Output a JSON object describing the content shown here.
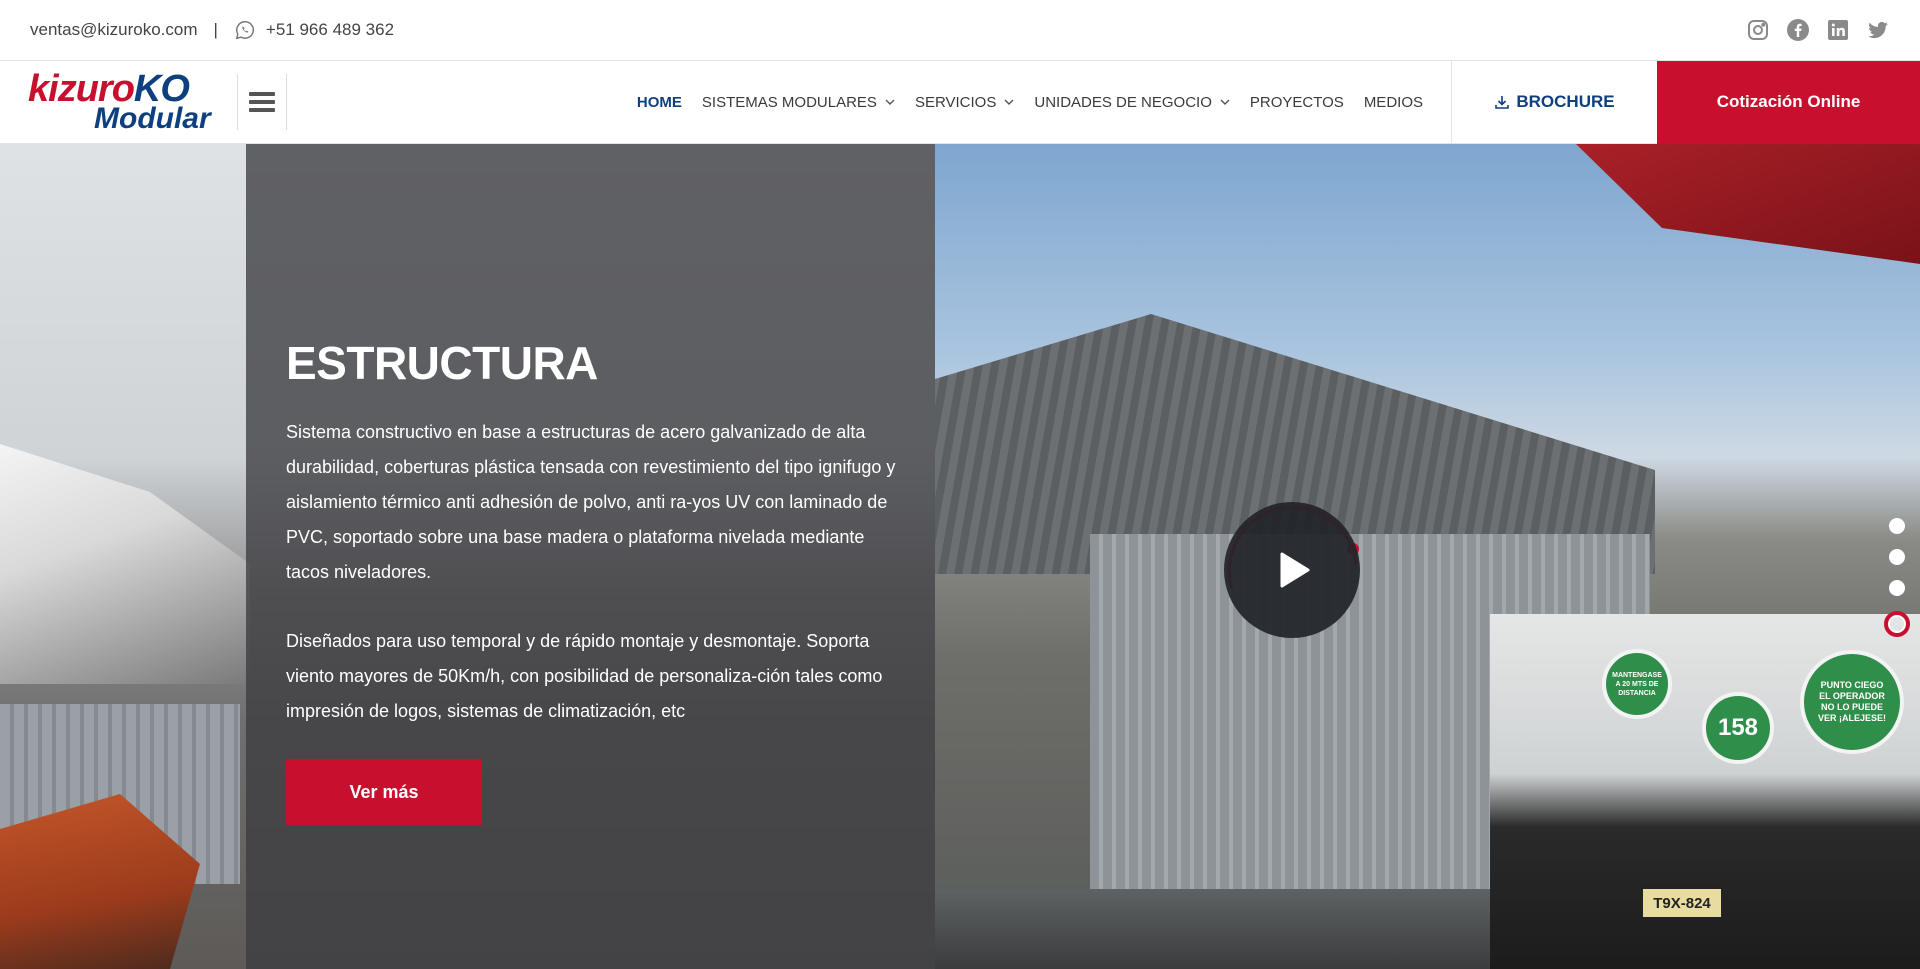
{
  "topbar": {
    "email": "ventas@kizuroko.com",
    "separator": "|",
    "phone": "+51 966 489 362",
    "social": [
      "instagram-icon",
      "facebook-icon",
      "linkedin-icon",
      "twitter-icon"
    ]
  },
  "logo": {
    "line1_red": "kizuro",
    "line1_blue": "KO",
    "line2": "Modular"
  },
  "nav": {
    "items": [
      {
        "label": "HOME",
        "active": true,
        "dropdown": false
      },
      {
        "label": "SISTEMAS MODULARES",
        "active": false,
        "dropdown": true
      },
      {
        "label": "SERVICIOS",
        "active": false,
        "dropdown": true
      },
      {
        "label": "UNIDADES DE NEGOCIO",
        "active": false,
        "dropdown": true
      },
      {
        "label": "PROYECTOS",
        "active": false,
        "dropdown": false
      },
      {
        "label": "MEDIOS",
        "active": false,
        "dropdown": false
      }
    ],
    "brochure": "BROCHURE",
    "cotizacion": "Cotización Online"
  },
  "hero": {
    "title": "ESTRUCTURA",
    "paragraph1": "Sistema constructivo en base a estructuras de acero galvanizado de alta durabilidad, coberturas plástica tensada con revestimiento del tipo ignifugo y aislamiento térmico anti adhesión de polvo, anti ra-yos UV con laminado de PVC, soportado sobre una base madera o plataforma nivelada mediante tacos niveladores.",
    "paragraph2": "Diseñados para uso temporal y de rápido montaje y desmontaje. Soporta viento mayores de 50Km/h, con posibilidad de personaliza-ción tales como impresión de logos, sistemas de climatización, etc",
    "button": "Ver más",
    "slides_total": 4,
    "slide_active": 4
  },
  "photo_signs": {
    "sign1": "MANTENGASE A 20 MTS DE DISTANCIA",
    "sign2": "158",
    "sign3": "PUNTO CIEGO EL OPERADOR NO LO PUEDE VER ¡ALEJESE!",
    "plate": "T9X-824"
  },
  "colors": {
    "brand_red": "#c8102e",
    "brand_blue": "#0e3f7e"
  }
}
